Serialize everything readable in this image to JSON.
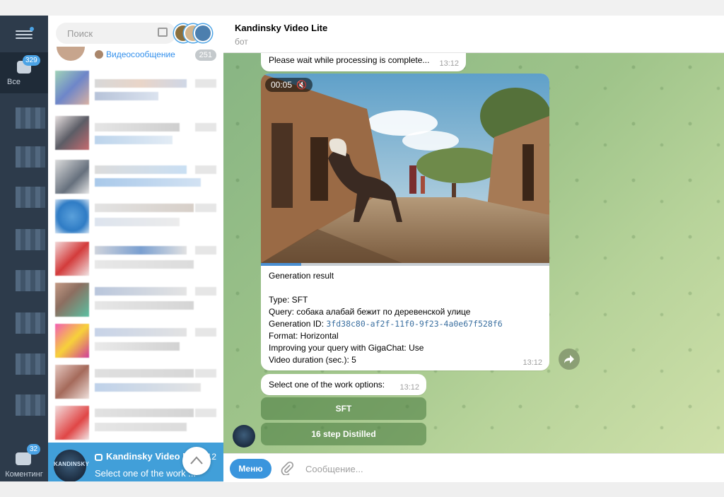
{
  "folders": {
    "all_label": "Все",
    "all_badge": "329",
    "comments_label": "Коментинг",
    "comments_badge": "32"
  },
  "chatlist": {
    "search_placeholder": "Поиск",
    "top_row": {
      "message": "Видеосообщение",
      "count": "251"
    },
    "active_chat": {
      "name": "Kandinsky Video L...",
      "time": "12",
      "last_message": "Select one of the work ...",
      "avatar_text": "KANDINSKY"
    }
  },
  "header": {
    "title": "Kandinsky Video Lite",
    "subtitle": "бот"
  },
  "messages": {
    "wait": {
      "text": "Please wait while processing is complete...",
      "time": "13:12"
    },
    "result": {
      "video_time": "00:05",
      "progress_fraction": 0.14,
      "lines": {
        "heading": "Generation result",
        "type": "Type: SFT",
        "query": "Query: собака алабай бежит по деревенской улице",
        "gen_id_label": "Generation ID: ",
        "gen_id": "3fd38c80-af2f-11f0-9f23-4a0e67f528f6",
        "format": "Format: Horizontal",
        "improving": "Improving your query with GigaChat: Use",
        "duration": "Video duration (sec.): 5"
      },
      "time": "13:12"
    },
    "select": {
      "text": "Select one of the work options:",
      "time": "13:12"
    }
  },
  "keyboard": {
    "button1": "SFT",
    "button2": "16 step Distilled"
  },
  "composer": {
    "menu_label": "Меню",
    "placeholder": "Сообщение..."
  },
  "colors": {
    "accent": "#419fd9",
    "rail": "#2d3b4b",
    "chat_bg": "#9fc48a"
  }
}
